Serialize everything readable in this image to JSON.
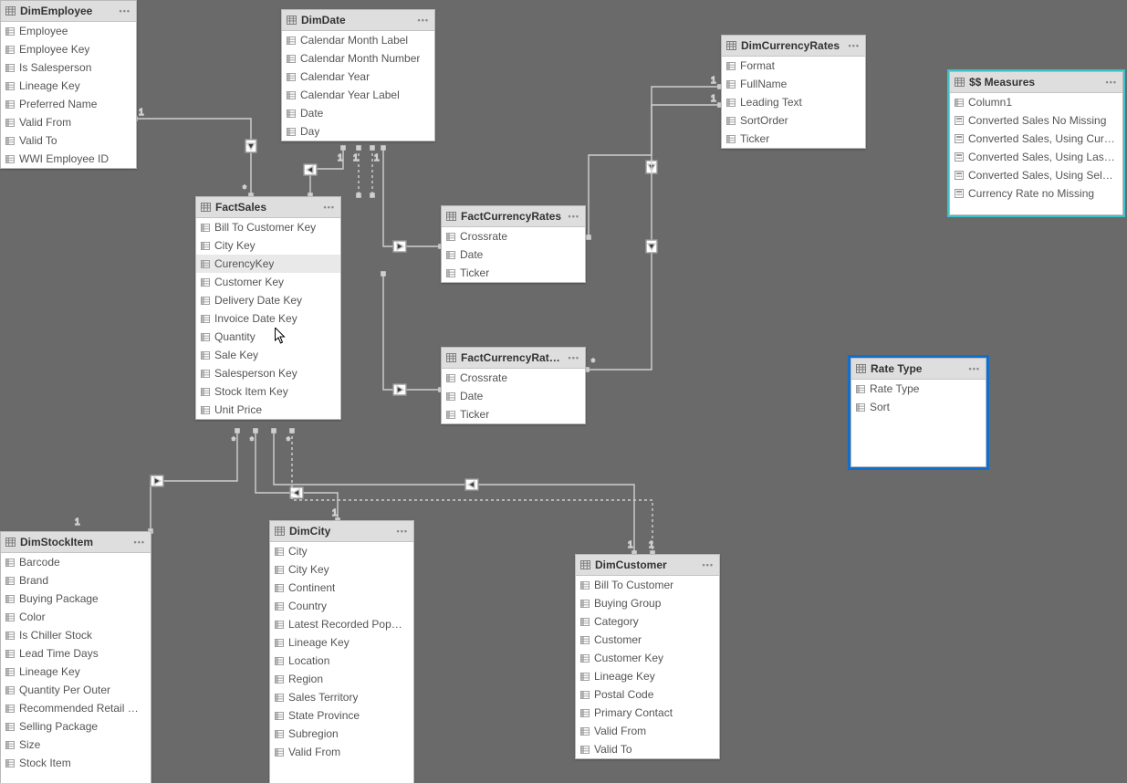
{
  "tables": {
    "dimEmployee": {
      "title": "DimEmployee",
      "fields": [
        "Employee",
        "Employee Key",
        "Is Salesperson",
        "Lineage Key",
        "Preferred Name",
        "Valid From",
        "Valid To",
        "WWI Employee ID"
      ]
    },
    "dimDate": {
      "title": "DimDate",
      "fields": [
        "Calendar Month Label",
        "Calendar Month Number",
        "Calendar Year",
        "Calendar Year Label",
        "Date",
        "Day"
      ]
    },
    "dimCurrencyRates": {
      "title": "DimCurrencyRates",
      "fields": [
        "Format",
        "FullName",
        "Leading Text",
        "SortOrder",
        "Ticker"
      ]
    },
    "measures": {
      "title": "$$ Measures",
      "fields": [
        "Column1",
        "Converted Sales No Missing",
        "Converted Sales, Using Current ...",
        "Converted Sales, Using Last Rep...",
        "Converted Sales, Using Selected...",
        "Currency Rate no Missing"
      ]
    },
    "factSales": {
      "title": "FactSales",
      "fields": [
        "Bill To Customer Key",
        "City Key",
        "CurencyKey",
        "Customer Key",
        "Delivery Date Key",
        "Invoice Date Key",
        "Quantity",
        "Sale Key",
        "Salesperson Key",
        "Stock Item Key",
        "Unit Price"
      ]
    },
    "factCurrencyRates": {
      "title": "FactCurrencyRates",
      "fields": [
        "Crossrate",
        "Date",
        "Ticker"
      ]
    },
    "factCurrencyRatesDup": {
      "title": "FactCurrencyRates...",
      "fields": [
        "Crossrate",
        "Date",
        "Ticker"
      ]
    },
    "rateType": {
      "title": "Rate Type",
      "fields": [
        "Rate Type",
        "Sort"
      ]
    },
    "dimStockItem": {
      "title": "DimStockItem",
      "fields": [
        "Barcode",
        "Brand",
        "Buying Package",
        "Color",
        "Is Chiller Stock",
        "Lead Time Days",
        "Lineage Key",
        "Quantity Per Outer",
        "Recommended Retail Price",
        "Selling Package",
        "Size",
        "Stock Item"
      ]
    },
    "dimCity": {
      "title": "DimCity",
      "fields": [
        "City",
        "City Key",
        "Continent",
        "Country",
        "Latest Recorded Populati...",
        "Lineage Key",
        "Location",
        "Region",
        "Sales Territory",
        "State Province",
        "Subregion",
        "Valid From"
      ]
    },
    "dimCustomer": {
      "title": "DimCustomer",
      "fields": [
        "Bill To Customer",
        "Buying Group",
        "Category",
        "Customer",
        "Customer Key",
        "Lineage Key",
        "Postal Code",
        "Primary Contact",
        "Valid From",
        "Valid To"
      ]
    }
  },
  "relationLabels": {
    "one": "1",
    "many": "*"
  }
}
